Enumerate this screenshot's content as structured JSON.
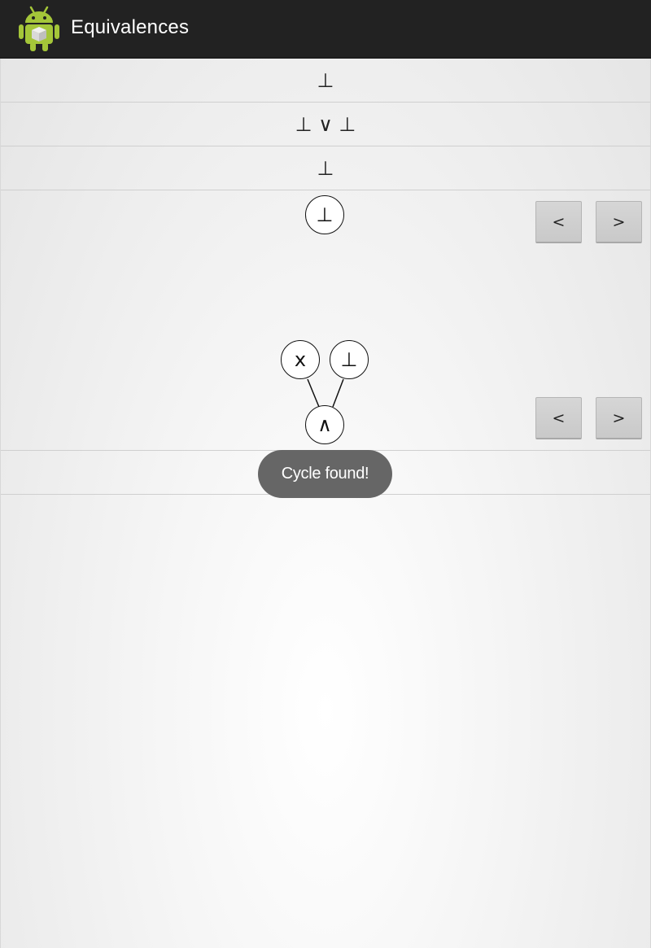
{
  "app": {
    "title": "Equivalences",
    "icon": "android-robot-icon"
  },
  "formula_rows": [
    {
      "text": "⊥"
    },
    {
      "text": "⊥ ∨ ⊥"
    },
    {
      "text": "⊥"
    }
  ],
  "tree_panels": [
    {
      "nodes": [
        {
          "label": "⊥",
          "role": "root"
        }
      ],
      "prev_label": "<",
      "next_label": ">"
    },
    {
      "nodes": [
        {
          "label": "x",
          "role": "left-child"
        },
        {
          "label": "⊥",
          "role": "right-child"
        },
        {
          "label": "∧",
          "role": "root"
        }
      ],
      "prev_label": "<",
      "next_label": ">"
    }
  ],
  "toast": {
    "message": "Cycle found!"
  },
  "colors": {
    "action_bar": "#222222",
    "toast_background": "#666666",
    "android_green": "#a4c639"
  }
}
